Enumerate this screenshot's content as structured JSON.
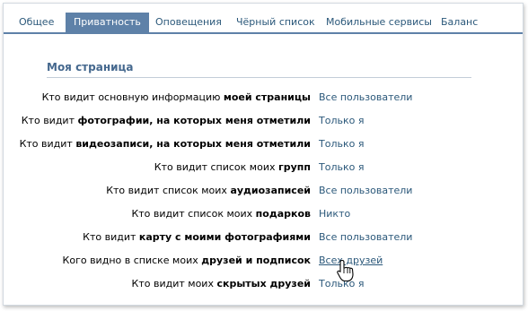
{
  "tabs": [
    {
      "label": "Общее"
    },
    {
      "label": "Приватность"
    },
    {
      "label": "Оповещения"
    },
    {
      "label": "Чёрный список"
    },
    {
      "label": "Мобильные сервисы"
    },
    {
      "label": "Баланс"
    }
  ],
  "active_tab": "Приватность",
  "section": {
    "title": "Моя страница"
  },
  "rows": [
    {
      "pre": "Кто видит основную информацию ",
      "bold": "моей страницы",
      "value": "Все пользователи"
    },
    {
      "pre": "Кто видит ",
      "bold": "фотографии, на которых меня отметили",
      "value": "Только я"
    },
    {
      "pre": "Кто видит ",
      "bold": "видеозаписи, на которых меня отметили",
      "value": "Только я"
    },
    {
      "pre": "Кто видит список моих ",
      "bold": "групп",
      "value": "Только я"
    },
    {
      "pre": "Кто видит список моих ",
      "bold": "аудиозаписей",
      "value": "Все пользователи"
    },
    {
      "pre": "Кто видит список моих ",
      "bold": "подарков",
      "value": "Никто"
    },
    {
      "pre": "Кто видит ",
      "bold": "карту с моими фотографиями",
      "value": "Все пользователи"
    },
    {
      "pre": "Кого видно в списке моих ",
      "bold": "друзей и подписок",
      "value": "Всех друзей"
    },
    {
      "pre": "Кто видит моих ",
      "bold": "скрытых друзей",
      "value": "Только я"
    }
  ],
  "cursor_icon": "hand-pointer-icon"
}
